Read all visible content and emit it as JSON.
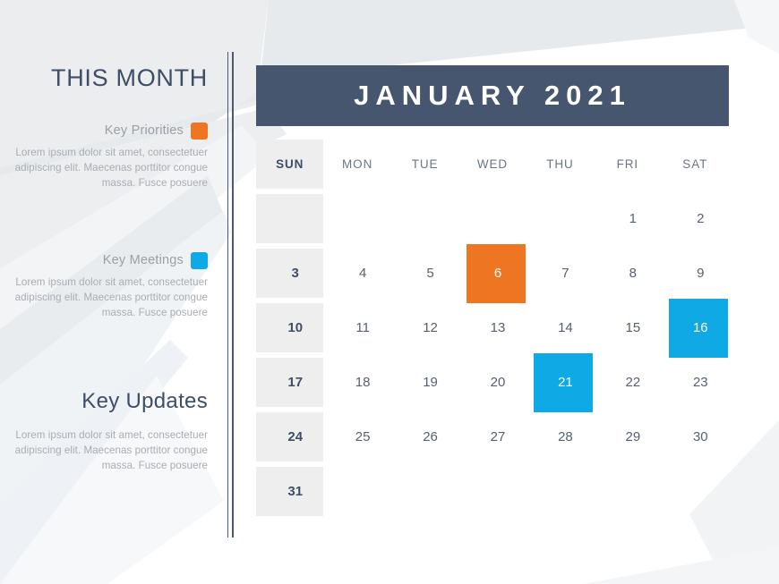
{
  "theme": {
    "accent_orange": "#ee7623",
    "accent_blue": "#0fa9e6",
    "header_slate": "#46566e",
    "title_slate": "#3e4e66",
    "sunday_shade": "#eeeeee",
    "body_gray": "#a8adb3"
  },
  "sidebar": {
    "title": "THIS MONTH",
    "updates_title": "Key Updates",
    "blocks": [
      {
        "label": "Key Priorities",
        "swatch_color": "#ee7623",
        "body": "Lorem ipsum dolor sit amet, consectetuer adipiscing elit. Maecenas porttitor congue massa. Fusce posuere"
      },
      {
        "label": "Key Meetings",
        "swatch_color": "#0fa9e6",
        "body": "Lorem ipsum dolor sit amet, consectetuer adipiscing elit. Maecenas porttitor congue massa. Fusce posuere"
      },
      {
        "label": "Key Updates",
        "swatch_color": null,
        "body": "Lorem ipsum dolor sit amet, consectetuer adipiscing elit. Maecenas porttitor congue massa. Fusce posuere"
      }
    ]
  },
  "calendar": {
    "title": "JANUARY 2021",
    "month": "JANUARY",
    "year": "2021",
    "weekdays": [
      "SUN",
      "MON",
      "TUE",
      "WED",
      "THU",
      "FRI",
      "SAT"
    ],
    "weeks": [
      [
        {
          "day": "",
          "highlight": null
        },
        {
          "day": "",
          "highlight": null
        },
        {
          "day": "",
          "highlight": null
        },
        {
          "day": "",
          "highlight": null
        },
        {
          "day": "",
          "highlight": null
        },
        {
          "day": "1",
          "highlight": null
        },
        {
          "day": "2",
          "highlight": null
        }
      ],
      [
        {
          "day": "3",
          "highlight": null
        },
        {
          "day": "4",
          "highlight": null
        },
        {
          "day": "5",
          "highlight": null
        },
        {
          "day": "6",
          "highlight": "#ee7623"
        },
        {
          "day": "7",
          "highlight": null
        },
        {
          "day": "8",
          "highlight": null
        },
        {
          "day": "9",
          "highlight": null
        }
      ],
      [
        {
          "day": "10",
          "highlight": null
        },
        {
          "day": "11",
          "highlight": null
        },
        {
          "day": "12",
          "highlight": null
        },
        {
          "day": "13",
          "highlight": null
        },
        {
          "day": "14",
          "highlight": null
        },
        {
          "day": "15",
          "highlight": null
        },
        {
          "day": "16",
          "highlight": "#0fa9e6"
        }
      ],
      [
        {
          "day": "17",
          "highlight": null
        },
        {
          "day": "18",
          "highlight": null
        },
        {
          "day": "19",
          "highlight": null
        },
        {
          "day": "20",
          "highlight": null
        },
        {
          "day": "21",
          "highlight": "#0fa9e6"
        },
        {
          "day": "22",
          "highlight": null
        },
        {
          "day": "23",
          "highlight": null
        }
      ],
      [
        {
          "day": "24",
          "highlight": null
        },
        {
          "day": "25",
          "highlight": null
        },
        {
          "day": "26",
          "highlight": null
        },
        {
          "day": "27",
          "highlight": null
        },
        {
          "day": "28",
          "highlight": null
        },
        {
          "day": "29",
          "highlight": null
        },
        {
          "day": "30",
          "highlight": null
        }
      ],
      [
        {
          "day": "31",
          "highlight": null
        },
        {
          "day": "",
          "highlight": null
        },
        {
          "day": "",
          "highlight": null
        },
        {
          "day": "",
          "highlight": null
        },
        {
          "day": "",
          "highlight": null
        },
        {
          "day": "",
          "highlight": null
        },
        {
          "day": "",
          "highlight": null
        }
      ]
    ]
  }
}
